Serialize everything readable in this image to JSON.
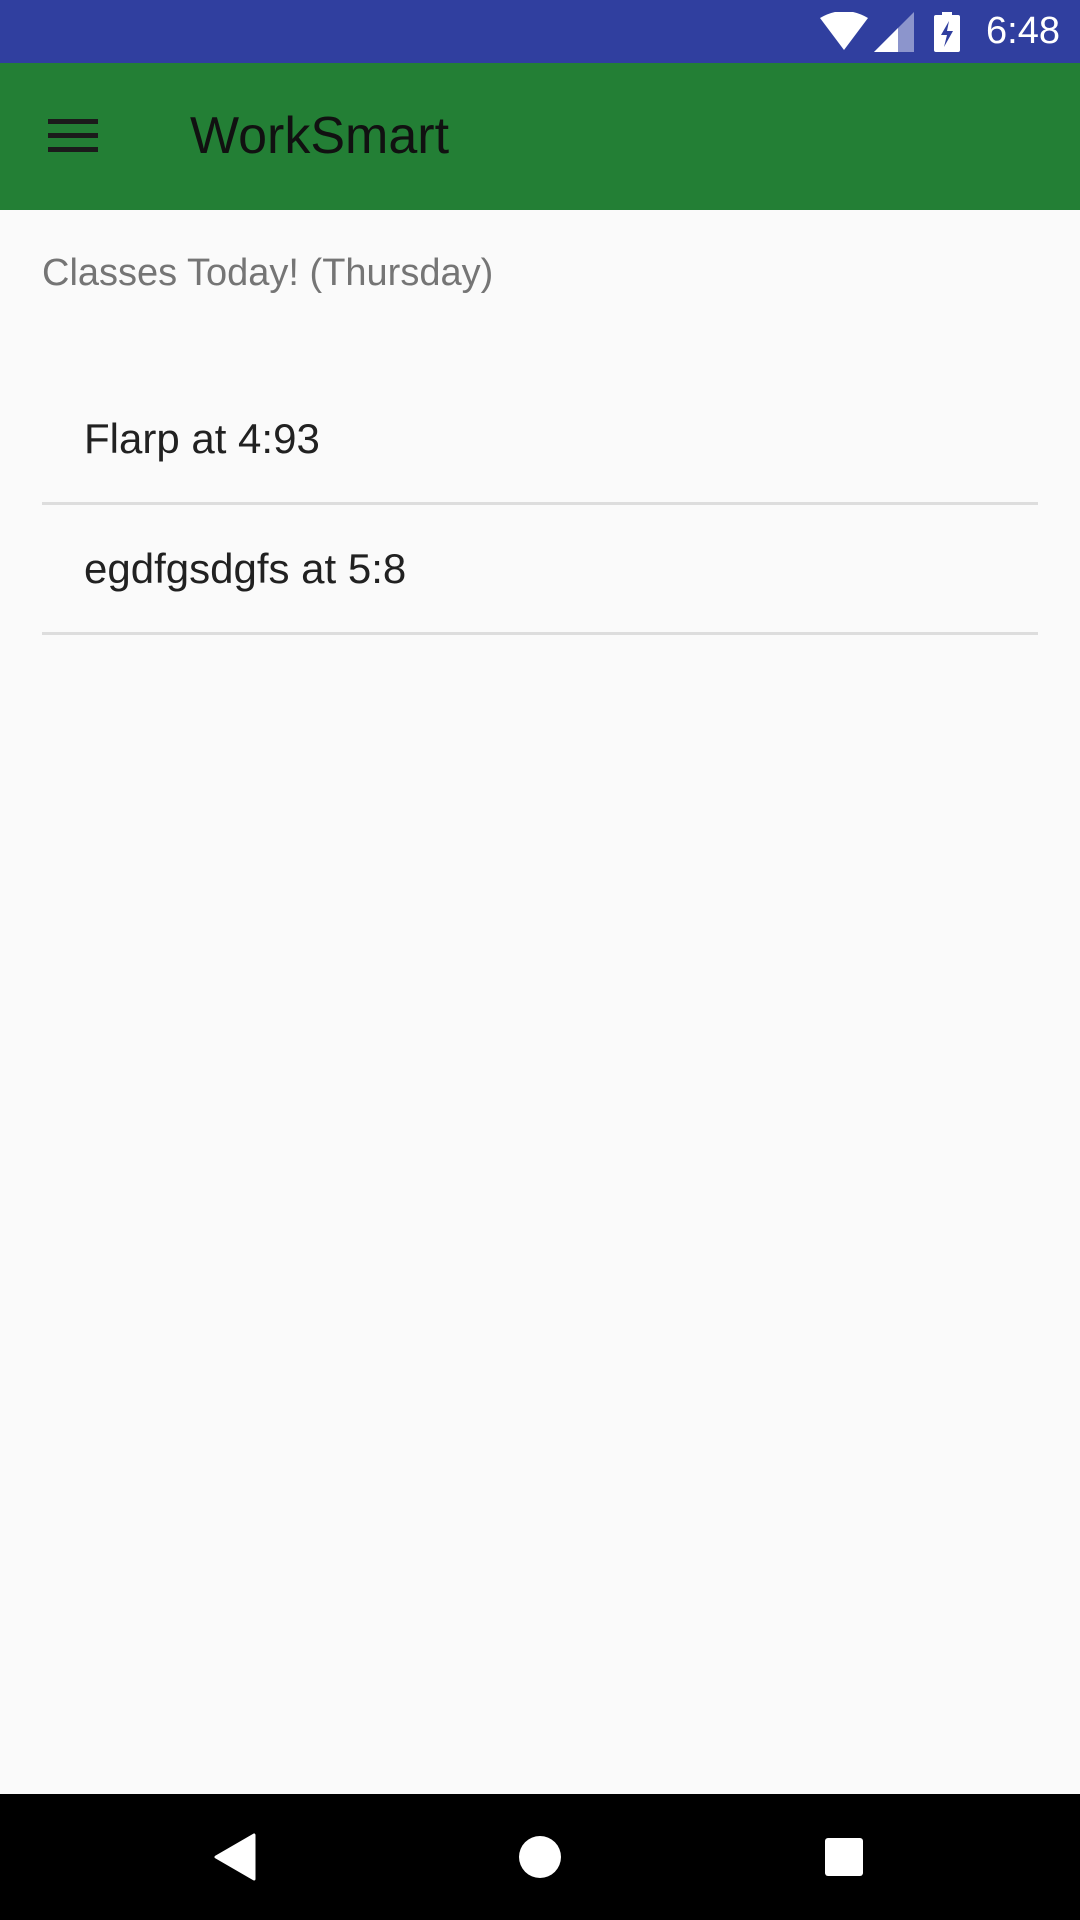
{
  "status_bar": {
    "time": "6:48",
    "icons": [
      "wifi-icon",
      "cell-signal-icon",
      "battery-charging-icon"
    ],
    "background": "#303f9f"
  },
  "app_bar": {
    "title": "WorkSmart",
    "menu_icon": "hamburger-menu-icon",
    "background": "#237f35"
  },
  "main": {
    "header": "Classes Today! (Thursday)",
    "classes": [
      {
        "label": "Flarp at 4:93"
      },
      {
        "label": "egdfgsdgfs at 5:8"
      }
    ]
  },
  "nav_bar": {
    "buttons": [
      "back-icon",
      "home-icon",
      "recents-icon"
    ]
  }
}
